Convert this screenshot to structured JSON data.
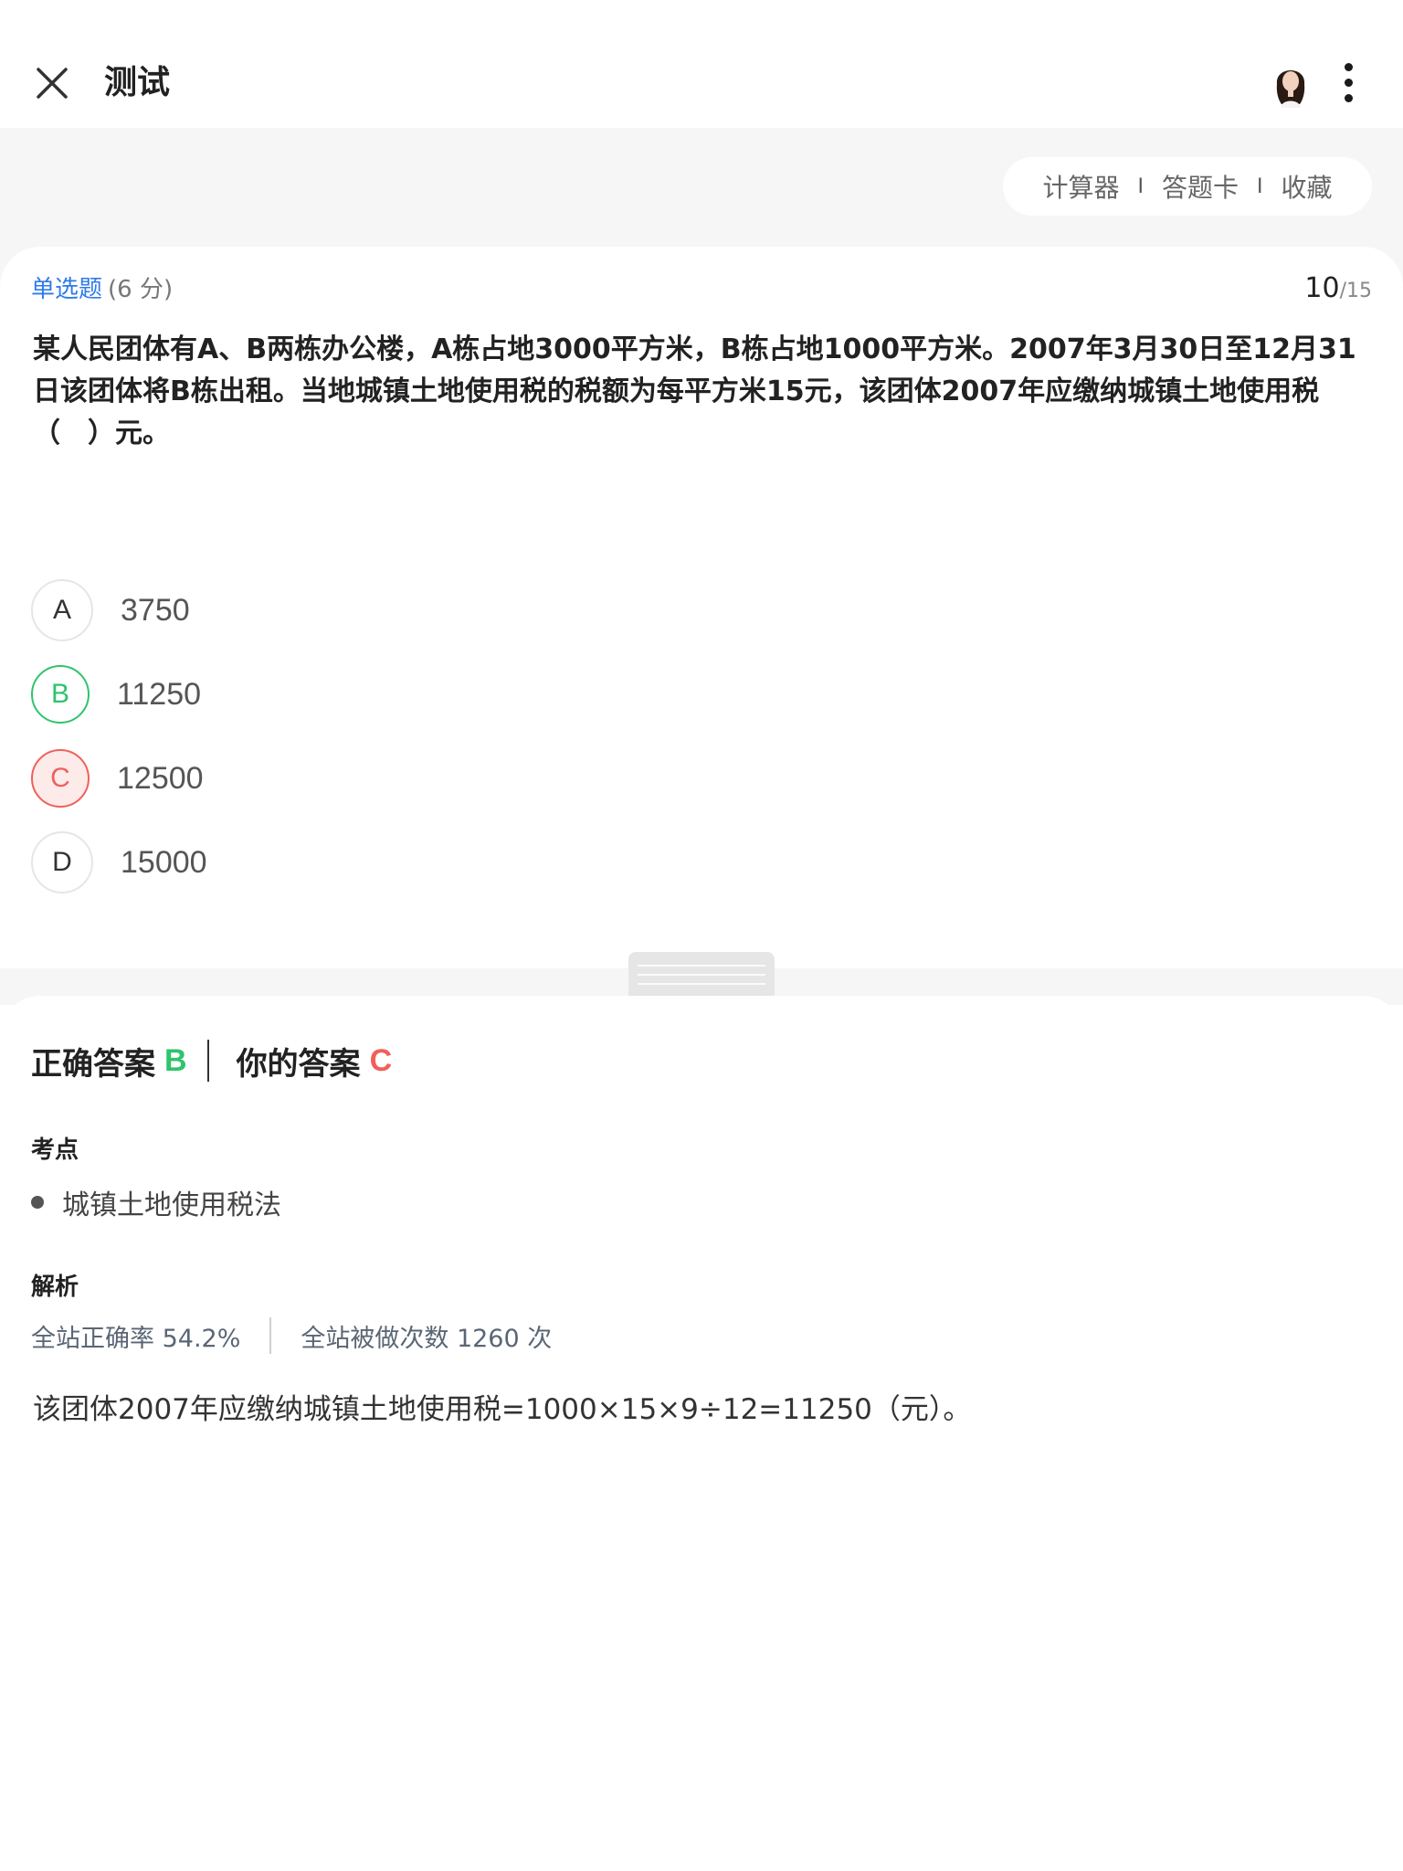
{
  "header": {
    "title": "测试"
  },
  "toolbar": {
    "calculator": "计算器",
    "answer_card": "答题卡",
    "favorite": "收藏",
    "separator": "I"
  },
  "question": {
    "type_label": "单选题",
    "score": "(6 分)",
    "current": "10",
    "total": "/15",
    "text": "某人民团体有A、B两栋办公楼，A栋占地3000平方米，B栋占地1000平方米。2007年3月30日至12月31日该团体将B栋出租。当地城镇土地使用税的税额为每平方米15元，该团体2007年应缴纳城镇土地使用税（　）元。",
    "options": [
      {
        "key": "A",
        "text": "3750"
      },
      {
        "key": "B",
        "text": "11250"
      },
      {
        "key": "C",
        "text": "12500"
      },
      {
        "key": "D",
        "text": "15000"
      }
    ]
  },
  "answer": {
    "correct_label": "正确答案",
    "correct_value": "B",
    "yours_label": "你的答案",
    "yours_value": "C"
  },
  "knowledge_point": {
    "title": "考点",
    "items": [
      "城镇土地使用税法"
    ]
  },
  "analysis": {
    "title": "解析",
    "accuracy": "全站正确率 54.2%",
    "attempts": "全站被做次数 1260 次",
    "text": "该团体2007年应缴纳城镇土地使用税=1000×15×9÷12=11250（元）。"
  },
  "colors": {
    "correct": "#2fc46b",
    "wrong": "#f0605a",
    "accent": "#2f7bea"
  },
  "icons": {
    "close": "close-icon",
    "more": "more-vertical-icon",
    "avatar": "user-avatar"
  }
}
